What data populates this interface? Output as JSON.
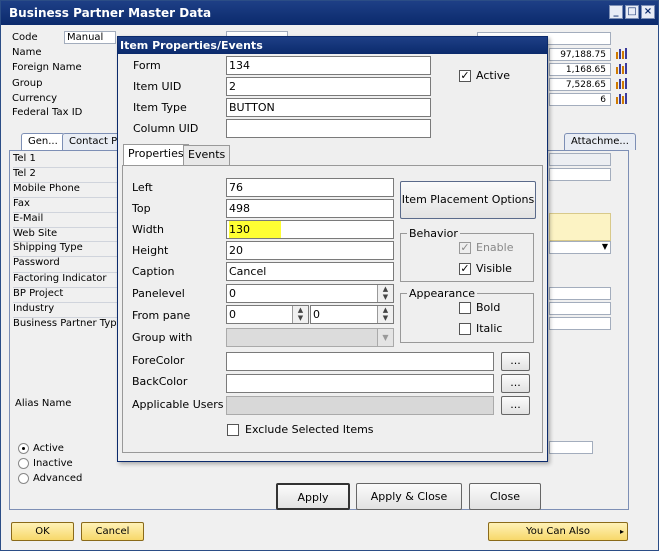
{
  "window": {
    "title": "Business Partner Master Data",
    "controls": [
      "_",
      "□",
      "×"
    ]
  },
  "header": {
    "code_label": "Code",
    "code_mode": "Manual",
    "name_label": "Name",
    "foreign_name_label": "Foreign Name",
    "group_label": "Group",
    "currency_label": "Currency",
    "federal_tax_label": "Federal Tax ID",
    "values": [
      "97,188.75",
      "1,168.65",
      "7,528.65",
      "6"
    ]
  },
  "tabs": [
    "Gen...",
    "Contact P",
    "Attachme..."
  ],
  "left_fields": [
    "Tel 1",
    "Tel 2",
    "Mobile Phone",
    "Fax",
    "E-Mail",
    "Web Site",
    "Shipping Type",
    "Password",
    "Factoring Indicator",
    "BP Project",
    "Industry",
    "Business Partner Type"
  ],
  "alias_label": "Alias Name",
  "status_options": [
    "Active",
    "Inactive",
    "Advanced"
  ],
  "footer": {
    "ok": "OK",
    "cancel": "Cancel",
    "you_can_also": "You Can Also"
  },
  "dialog": {
    "title": "Item Properties/Events",
    "form_label": "Form",
    "form_value": "134",
    "item_uid_label": "Item UID",
    "item_uid_value": "2",
    "item_type_label": "Item Type",
    "item_type_value": "BUTTON",
    "column_uid_label": "Column UID",
    "column_uid_value": "",
    "active_label": "Active",
    "tabs": [
      "Properties",
      "Events"
    ],
    "left_label": "Left",
    "left_value": "76",
    "top_label": "Top",
    "top_value": "498",
    "width_label": "Width",
    "width_value": "130",
    "height_label": "Height",
    "height_value": "20",
    "caption_label": "Caption",
    "caption_value": "Cancel",
    "panelevel_label": "Panelevel",
    "panelevel_value": "0",
    "from_pane_label": "From pane",
    "from_pane_value": "0",
    "to_pane_value": "0",
    "group_with_label": "Group with",
    "forecolor_label": "ForeColor",
    "backcolor_label": "BackColor",
    "applicable_users_label": "Applicable Users",
    "ellipsis": "...",
    "placement_button": "Item Placement Options",
    "behavior_title": "Behavior",
    "enable_label": "Enable",
    "visible_label": "Visible",
    "appearance_title": "Appearance",
    "bold_label": "Bold",
    "italic_label": "Italic",
    "exclude_label": "Exclude Selected Items",
    "apply_button": "Apply",
    "apply_close_button": "Apply & Close",
    "close_button": "Close",
    "highlight_color": "#ffff33"
  }
}
